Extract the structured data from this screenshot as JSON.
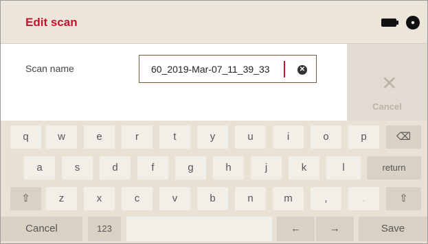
{
  "header": {
    "title": "Edit scan",
    "battery_icon": "battery-icon",
    "disc_icon": "disc-icon"
  },
  "form": {
    "scan_name_label": "Scan name",
    "scan_name_value": "60_2019-Mar-07_11_39_33",
    "clear_icon": "clear-circle-icon",
    "clear_glyph": "✕"
  },
  "side": {
    "cancel_label": "Cancel",
    "x_glyph": "✕"
  },
  "keyboard": {
    "row1": [
      "q",
      "w",
      "e",
      "r",
      "t",
      "y",
      "u",
      "i",
      "o",
      "p"
    ],
    "backspace": "⌫",
    "row2": [
      "a",
      "s",
      "d",
      "f",
      "g",
      "h",
      "j",
      "k",
      "l"
    ],
    "return": "return",
    "shift": "⇧",
    "row3": [
      "z",
      "x",
      "c",
      "v",
      "b",
      "n",
      "m",
      ",",
      "."
    ],
    "cancel": "Cancel",
    "numbers": "123",
    "space": "",
    "left": "←",
    "right": "→",
    "save": "Save"
  },
  "colors": {
    "accent": "#c4122f",
    "header_bg": "#ece6da",
    "keyboard_bg": "#e8e1d4",
    "key_bg": "#f2efe9",
    "key_dark_bg": "#d9d1c3"
  }
}
